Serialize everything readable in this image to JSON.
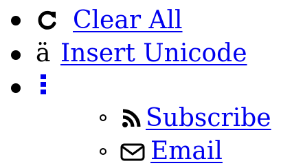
{
  "menu": {
    "items": [
      {
        "icon": "refresh-icon",
        "label": "Clear All"
      },
      {
        "icon": "a-umlaut-glyph",
        "glyph": "ä",
        "label": "Insert Unicode"
      },
      {
        "icon": "vertical-ellipsis-icon",
        "label": "",
        "children": [
          {
            "icon": "rss-icon",
            "label": "Subscribe"
          },
          {
            "icon": "envelope-icon",
            "label": "Email"
          }
        ]
      }
    ]
  },
  "colors": {
    "link": "#0000ee",
    "icon_accent": "#0000ee",
    "text": "#000000"
  }
}
